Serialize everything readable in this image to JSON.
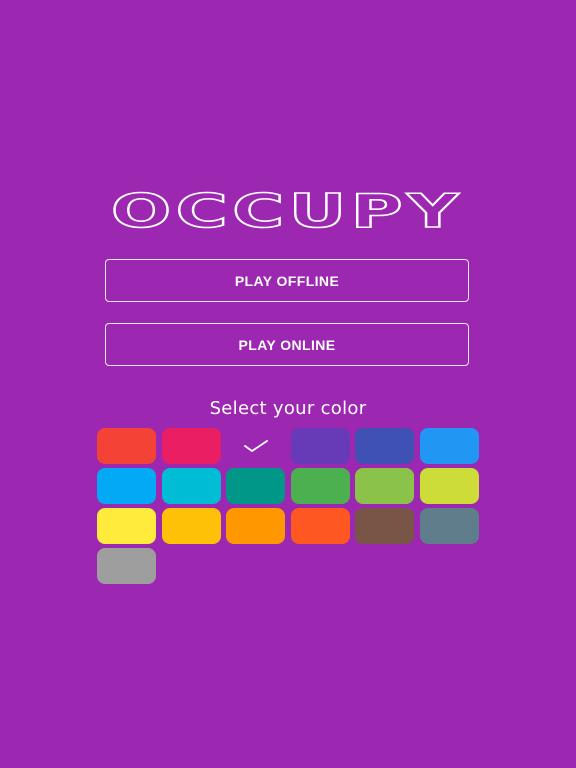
{
  "app": {
    "title": "OCCUPY",
    "background_color": "#9c27b0"
  },
  "menu": {
    "play_offline_label": "PLAY OFFLINE",
    "play_online_label": "PLAY ONLINE"
  },
  "color_picker": {
    "label": "Select your color",
    "selected_index": 2,
    "selected_icon": "check-icon",
    "swatches": [
      {
        "name": "red",
        "color": "#f44336"
      },
      {
        "name": "pink",
        "color": "#e91e63"
      },
      {
        "name": "purple",
        "color": "#9c27b0"
      },
      {
        "name": "deep-purple",
        "color": "#673ab7"
      },
      {
        "name": "indigo",
        "color": "#3f51b5"
      },
      {
        "name": "blue",
        "color": "#2196f3"
      },
      {
        "name": "light-blue",
        "color": "#03a9f4"
      },
      {
        "name": "cyan",
        "color": "#00bcd4"
      },
      {
        "name": "teal",
        "color": "#009688"
      },
      {
        "name": "green",
        "color": "#4caf50"
      },
      {
        "name": "light-green",
        "color": "#8bc34a"
      },
      {
        "name": "lime",
        "color": "#cddc39"
      },
      {
        "name": "yellow",
        "color": "#ffeb3b"
      },
      {
        "name": "amber",
        "color": "#ffc107"
      },
      {
        "name": "orange",
        "color": "#ff9800"
      },
      {
        "name": "deep-orange",
        "color": "#ff5722"
      },
      {
        "name": "brown",
        "color": "#795548"
      },
      {
        "name": "blue-grey",
        "color": "#607d8b"
      },
      {
        "name": "grey",
        "color": "#9e9e9e"
      }
    ]
  }
}
